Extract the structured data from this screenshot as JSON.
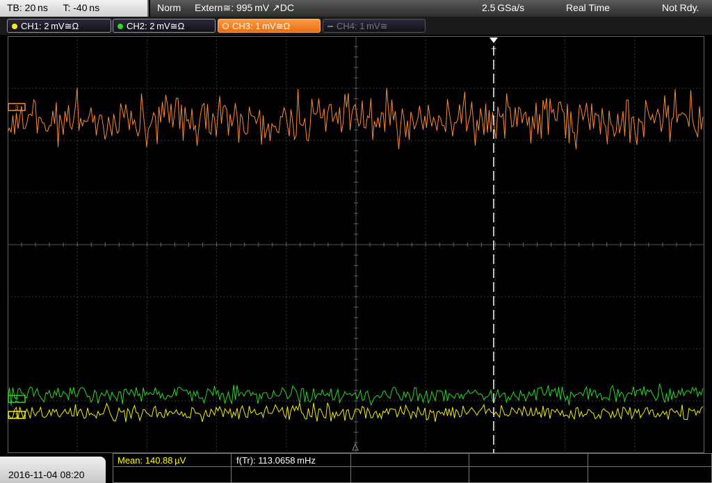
{
  "topbar": {
    "timebase": "TB: 20 ns",
    "trigger_offset": "T: -40 ns",
    "mode": "Norm",
    "trigger_source": "Extern≅: 995 mV ↗DC",
    "sample_rate": "2.5 GSa/s",
    "acquisition": "Real Time",
    "status": "Not Rdy."
  },
  "channels": [
    {
      "label": "CH1: 2 mV≅Ω",
      "color": "#f5f000",
      "state": "on"
    },
    {
      "label": "CH2: 2 mV≅Ω",
      "color": "#22dd22",
      "state": "on"
    },
    {
      "label": "CH3: 1 mV≅Ω",
      "color": "#ff8a2a",
      "state": "selected"
    },
    {
      "label": "CH4: 1 mV≅",
      "color": "#777777",
      "state": "off"
    }
  ],
  "markers": {
    "ch3": "3",
    "ch2": "2",
    "ch1": "1",
    "trigger": "T"
  },
  "bottom": {
    "datetime": "2016-11-04 08:20",
    "mean": "Mean: 140.88 µV",
    "freq": "f(Tr): 113.0658 mHz"
  },
  "colors": {
    "ch1": "#f5f000",
    "ch2": "#22dd22",
    "ch3": "#ff8a2a",
    "grid": "#3a3a3a",
    "mean_text": "#ffff00"
  }
}
